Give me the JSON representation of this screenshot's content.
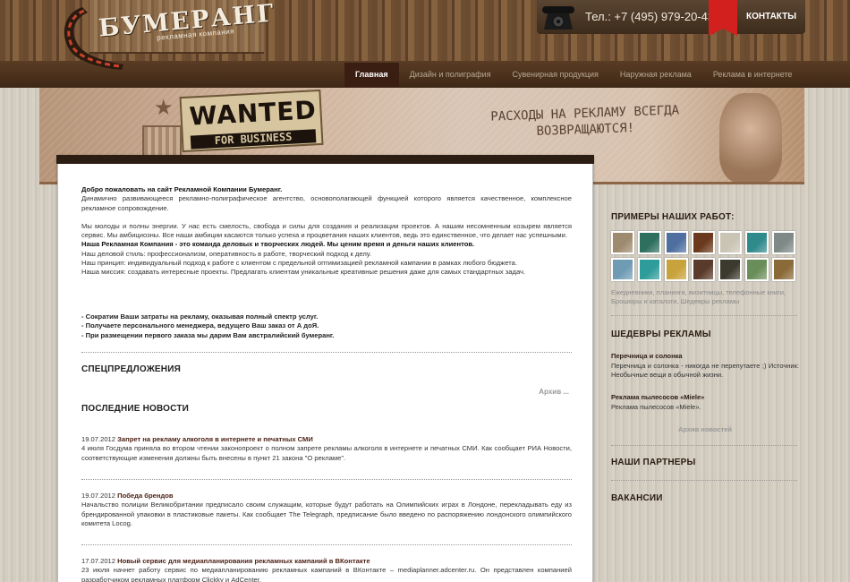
{
  "header": {
    "logo_text": "БУМЕРАНГ",
    "logo_sub": "рекламная компания",
    "phone": "Тел.: +7 (495) 979-20-43",
    "contacts": "КОНТАКТЫ"
  },
  "nav": [
    {
      "label": "Главная",
      "active": true
    },
    {
      "label": "Дизайн и полиграфия"
    },
    {
      "label": "Сувенирная продукция"
    },
    {
      "label": "Наружная реклама"
    },
    {
      "label": "Реклама в интернете"
    }
  ],
  "banner": {
    "wanted": "WANTED",
    "wanted_sub": "FOR BUSINESS",
    "slogan": "РАСХОДЫ НА РЕКЛАМУ ВСЕГДА ВОЗВРАЩАЮТСЯ!"
  },
  "intro": {
    "welcome": "Добро пожаловать на сайт Рекламной Компании Бумеранг.",
    "p1": "Динамично развивающееся рекламно-полиграфическое агентство, основополагающей функцией которого является качественное, комплексное рекламное сопровождение.",
    "p2": "Мы молоды и полны энергии. У нас есть смелость, свобода и силы для создания и реализации проектов. А нашим несомненным козырем является сервис. Мы амбициозны. Все наши амбиции касаются только успеха и процветания наших клиентов, ведь это единственное, что делает нас успешными.",
    "p3_bold": "Наша Рекламная Компания - это команда деловых и творческих людей. Мы ценим время и деньги наших клиентов.",
    "p4": "Наш деловой стиль: профессионализм, оперативность в работе, творческий подход к делу.",
    "p5": "Наш принцип: индивидуальный подход к работе с клиентом с предельной оптимизацией рекламной кампании в рамках любого бюджета.",
    "p6": "Наша миссия: создавать интересные проекты. Предлагать клиентам уникальные креативные решения даже для самых стандартных задач."
  },
  "bullets": [
    "- Сократим Ваши затраты на рекламу, оказывая полный спектр услуг.",
    "- Получаете персонального менеджера, ведущего Ваш заказ от А доЯ.",
    "- При размещении первого заказа мы дарим Вам австралийский бумеранг."
  ],
  "specials": {
    "title": "СПЕЦПРЕДЛОЖЕНИЯ",
    "archive": "Архив ..."
  },
  "news": {
    "title": "ПОСЛЕДНИЕ НОВОСТИ",
    "items": [
      {
        "date": "19.07.2012",
        "title": "Запрет на рекламу алкоголя в интернете и печатных СМИ",
        "text": "4 июля Госдума приняла во втором чтении законопроект о полном запрете рекламы алкоголя в интернете и печатных СМИ. Как сообщает РИА Новости, соответствующие изменения должны быть внесены в пункт 21 закона \"О рекламе\"."
      },
      {
        "date": "19.07.2012",
        "title": "Победа брендов",
        "text": "Начальство полиции Великобритании предписало своим служащим, которые будут работать на Олимпийских играх в Лондоне, перекладывать еду из брендированной упаковки в пластиковые пакеты. Как сообщает The Telegraph, предписание было введено по распоряжению лондонского олимпийского комитета Locog."
      },
      {
        "date": "17.07.2012",
        "title": "Новый сервис для медиапланирования рекламных кампаний в ВКонтакте",
        "text": "23 июля начнет работу сервис по медиапланированию рекламных кампаний в ВКонтакте – mediaplanner.adcenter.ru. Он представлен компанией разработчиком рекламных платформ Clickky и AdCenter."
      }
    ]
  },
  "sidebar": {
    "works_title": "ПРИМЕРЫ НАШИХ РАБОТ:",
    "work_links": "Ежедневники, планинги, визитницы, телефонные книги, Брошюры и каталоги, Шедевры рекламы",
    "thumb_colors": [
      "#9e8a6e",
      "#2f6f5e",
      "#4e6fa0",
      "#6b3a1e",
      "#c9c4b4",
      "#2f8a8c",
      "#7f8a86",
      "#6f9bb5",
      "#2e9c9a",
      "#c8a23a",
      "#5a3a2a",
      "#3c3a2e",
      "#6a8e5a",
      "#8b6a3a"
    ],
    "masterpieces_title": "ШЕДЕВРЫ РЕКЛАМЫ",
    "m1_title": "Перечница и солонка",
    "m1_text": "Перечница и солонка - никогда не перепутаете ;) Источник: Необычные вещи в обычной жизни.",
    "m2_title": "Реклама пылесосов «Miele»",
    "m2_text": "Реклама пылесосов «Miele».",
    "news_archive": "Архив новостей",
    "partners_title": "НАШИ ПАРТНЕРЫ",
    "vacancies_title": "ВАКАНСИИ"
  }
}
